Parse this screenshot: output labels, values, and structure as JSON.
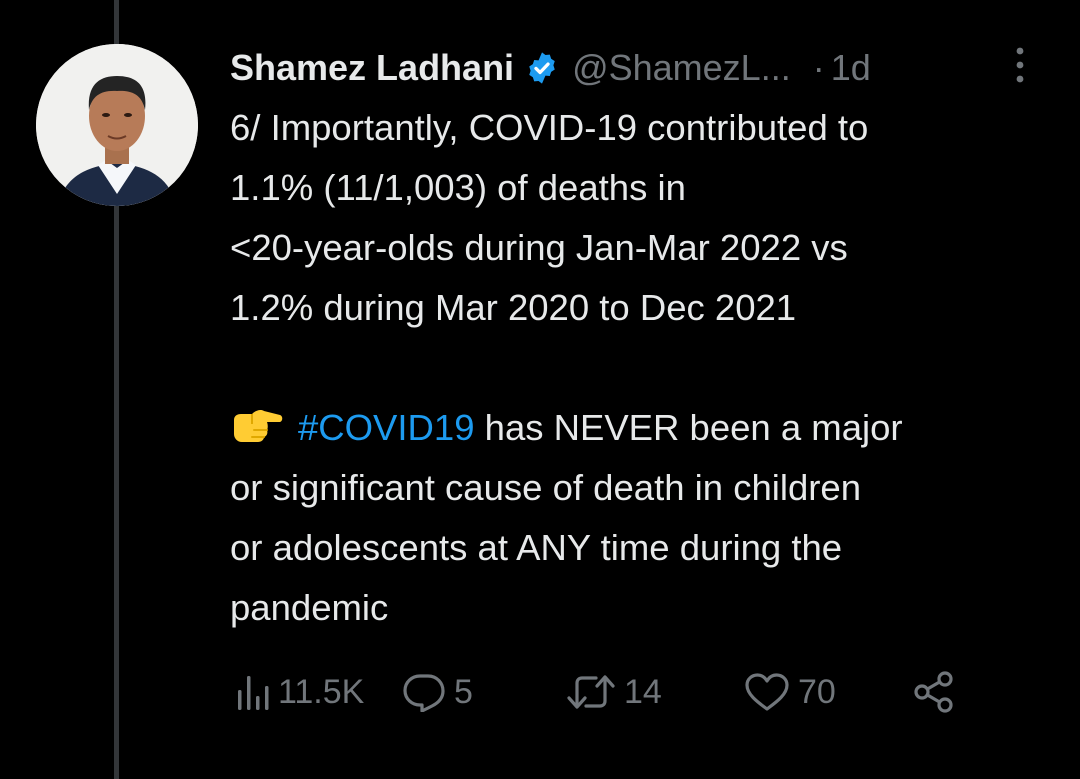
{
  "tweet": {
    "author": {
      "display_name": "Shamez Ladhani",
      "handle": "@ShamezL...",
      "verified": true
    },
    "separator": "·",
    "time": "1d",
    "text": {
      "line1": "6/ Importantly, COVID-19 contributed to",
      "line2": "1.1% (11/1,003) of deaths in",
      "line3": "<20-year-olds during Jan-Mar 2022 vs",
      "line4": "1.2% during Mar 2020 to Dec 2021",
      "hashtag": "#COVID19",
      "after_hashtag": " has NEVER been a major",
      "line6": "or significant cause of death in children",
      "line7": "or adolescents at ANY time during the",
      "line8": "pandemic"
    },
    "stats": {
      "views": "11.5K",
      "replies": "5",
      "retweets": "14",
      "likes": "70"
    }
  },
  "colors": {
    "background": "#000000",
    "text": "#e7e9ea",
    "secondary": "#71767b",
    "accent": "#1d9bf0",
    "thread_line": "#333639"
  },
  "icons": {
    "verified": "verified-badge-icon",
    "more": "more-vertical-icon",
    "emoji": "backhand-index-pointing-right-emoji",
    "views": "bar-chart-icon",
    "replies": "reply-icon",
    "retweets": "retweet-icon",
    "likes": "heart-icon",
    "share": "share-icon"
  }
}
